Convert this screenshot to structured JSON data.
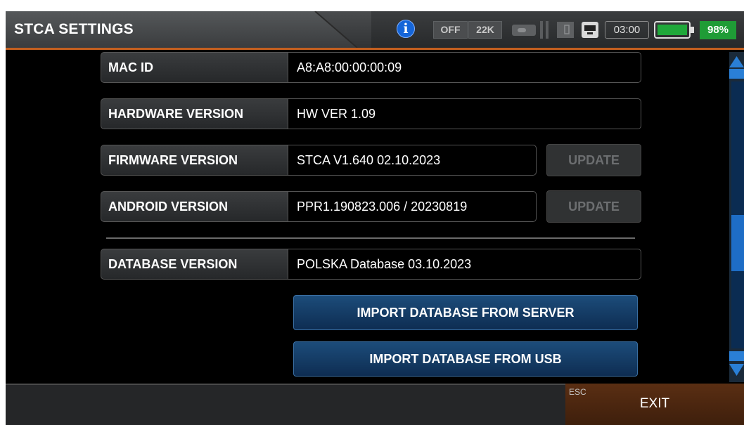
{
  "header": {
    "title": "STCA SETTINGS",
    "info_icon": "i",
    "status_off": "OFF",
    "status_22k": "22K",
    "time": "03:00",
    "battery": "98%",
    "colors": {
      "accent": "#c45f1f",
      "battery": "#1f9c36",
      "info": "#1565d8"
    }
  },
  "rows": [
    {
      "label": "MAC ID",
      "value": "A8:A8:00:00:00:09"
    },
    {
      "label": "HARDWARE VERSION",
      "value": "HW VER 1.09"
    },
    {
      "label": "FIRMWARE VERSION",
      "value": "STCA V1.640 02.10.2023",
      "action": "UPDATE"
    },
    {
      "label": "ANDROID VERSION",
      "value": "PPR1.190823.006 / 20230819",
      "action": "UPDATE"
    },
    {
      "label": "DATABASE VERSION",
      "value": "POLSKA Database 03.10.2023"
    }
  ],
  "buttons": {
    "import_server": "IMPORT DATABASE FROM SERVER",
    "import_usb": "IMPORT DATABASE FROM USB"
  },
  "footer": {
    "esc": "ESC",
    "exit": "EXIT"
  }
}
